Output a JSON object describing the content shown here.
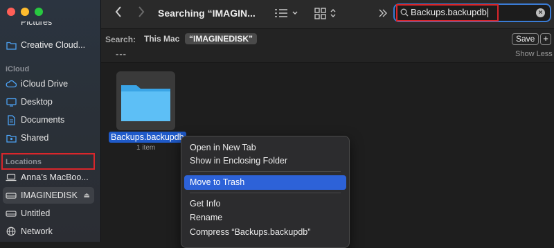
{
  "sidebar": {
    "items": [
      {
        "label": "Pictures"
      },
      {
        "label": "Creative Cloud..."
      },
      {
        "label": "iCloud Drive"
      },
      {
        "label": "Desktop"
      },
      {
        "label": "Documents"
      },
      {
        "label": "Shared"
      },
      {
        "label": "Anna’s MacBoo..."
      },
      {
        "label": "IMAGINEDISK"
      },
      {
        "label": "Untitled"
      },
      {
        "label": "Network"
      }
    ],
    "section_icloud": "iCloud",
    "section_locations": "Locations"
  },
  "toolbar": {
    "title": "Searching “IMAGIN...",
    "search_value": "Backups.backupdb"
  },
  "scope": {
    "label": "Search:",
    "this_mac": "This Mac",
    "disk": "“IMAGINEDISK”",
    "save": "Save",
    "plus": "+",
    "dashes": "---",
    "show_less": "Show Less"
  },
  "result": {
    "name": "Backups.backupdb",
    "subtitle": "1 item"
  },
  "context_menu": {
    "items": [
      {
        "label": "Open in New Tab"
      },
      {
        "label": "Show in Enclosing Folder"
      },
      {
        "label": "Move to Trash"
      },
      {
        "label": "Get Info"
      },
      {
        "label": "Rename"
      },
      {
        "label": "Compress “Backups.backupdb”"
      }
    ]
  },
  "colors": {
    "accent": "#2d62d8",
    "highlight_box": "#d9262b",
    "folder": "#4db3f3"
  }
}
